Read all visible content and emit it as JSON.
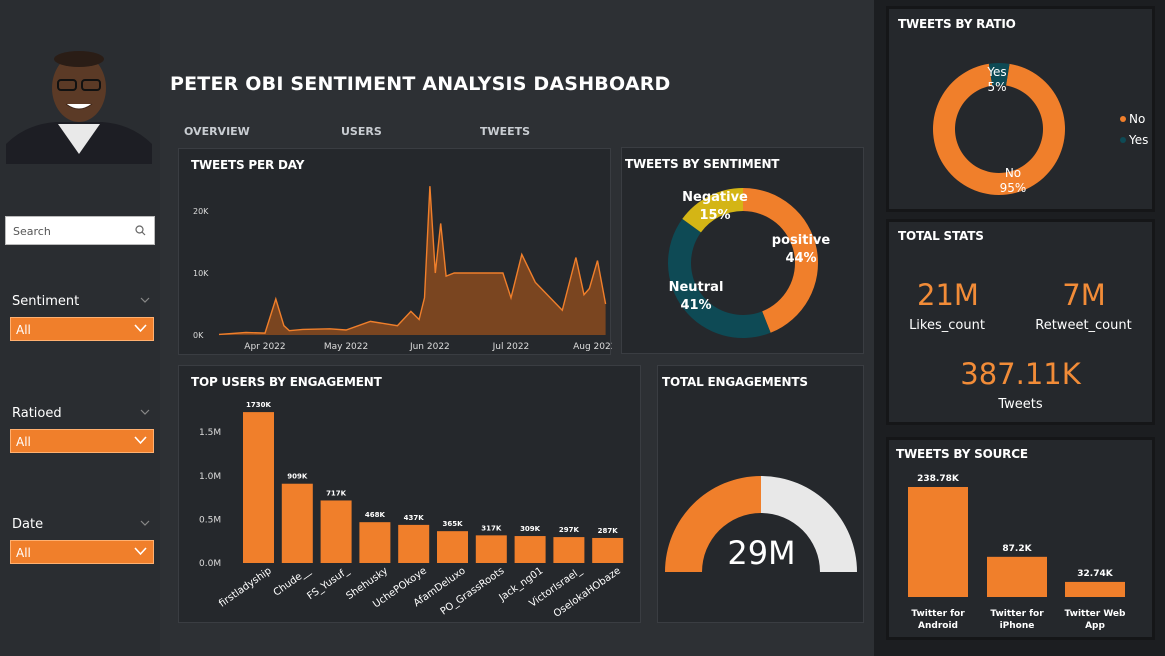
{
  "title": "PETER OBI SENTIMENT ANALYSIS DASHBOARD",
  "nav": {
    "overview": "OVERVIEW",
    "users": "USERS",
    "tweets": "TWEETS"
  },
  "colors": {
    "accent": "#f07f2b",
    "teal": "#0e4a55",
    "yellow": "#d4b515",
    "light": "#e8e8e8"
  },
  "sidebar": {
    "search_placeholder": "Search",
    "filters": [
      {
        "label": "Sentiment",
        "value": "All"
      },
      {
        "label": "Ratioed",
        "value": "All"
      },
      {
        "label": "Date",
        "value": "All"
      }
    ]
  },
  "tweets_per_day": {
    "title": "TWEETS PER DAY",
    "y_ticks": [
      "20K",
      "10K",
      "0K"
    ],
    "x_ticks": [
      "Apr 2022",
      "May 2022",
      "Jun 2022",
      "Jul 2022",
      "Aug 2022"
    ]
  },
  "sentiment": {
    "title": "TWEETS BY SENTIMENT",
    "labels": [
      {
        "name": "positive",
        "pct": "44%"
      },
      {
        "name": "Neutral",
        "pct": "41%"
      },
      {
        "name": "Negative",
        "pct": "15%"
      }
    ]
  },
  "top_users": {
    "title": "TOP USERS BY ENGAGEMENT",
    "y_ticks": [
      "1.5M",
      "1.0M",
      "0.5M",
      "0.0M"
    ]
  },
  "total_engagements": {
    "title": "TOTAL ENGAGEMENTS",
    "value": "29M"
  },
  "ratio": {
    "title": "TWEETS BY RATIO",
    "legend": [
      "No",
      "Yes"
    ],
    "yes_label": "Yes",
    "yes_pct": "5%",
    "no_label": "No",
    "no_pct": "95%"
  },
  "total_stats": {
    "title": "TOTAL STATS",
    "likes_value": "21M",
    "likes_label": "Likes_count",
    "retweet_value": "7M",
    "retweet_label": "Retweet_count",
    "tweets_value": "387.11K",
    "tweets_label": "Tweets"
  },
  "source": {
    "title": "TWEETS BY SOURCE",
    "bars": [
      {
        "label_1": "Twitter for",
        "label_2": "Android",
        "value_label": "238.78K"
      },
      {
        "label_1": "Twitter for",
        "label_2": "iPhone",
        "value_label": "87.2K"
      },
      {
        "label_1": "Twitter Web",
        "label_2": "App",
        "value_label": "32.74K"
      }
    ]
  },
  "chart_data": [
    {
      "type": "area",
      "title": "TWEETS PER DAY",
      "x_ticks": [
        "Apr 2022",
        "May 2022",
        "Jun 2022",
        "Jul 2022",
        "Aug 2022"
      ],
      "ylim": [
        0,
        20000
      ],
      "x": [
        "2022-03-15",
        "2022-03-25",
        "2022-04-01",
        "2022-04-05",
        "2022-04-08",
        "2022-04-10",
        "2022-04-15",
        "2022-04-25",
        "2022-05-01",
        "2022-05-10",
        "2022-05-20",
        "2022-05-25",
        "2022-05-28",
        "2022-05-30",
        "2022-06-01",
        "2022-06-03",
        "2022-06-05",
        "2022-06-07",
        "2022-06-10",
        "2022-06-20",
        "2022-06-28",
        "2022-07-01",
        "2022-07-05",
        "2022-07-10",
        "2022-07-20",
        "2022-07-25",
        "2022-07-28",
        "2022-07-30",
        "2022-08-02",
        "2022-08-05"
      ],
      "values": [
        100,
        400,
        300,
        5800,
        1500,
        700,
        900,
        1000,
        800,
        2200,
        1500,
        3800,
        2500,
        6000,
        24000,
        10000,
        18000,
        9500,
        10000,
        10000,
        10000,
        6000,
        13000,
        8500,
        4000,
        12500,
        6500,
        7500,
        12000,
        5000
      ]
    },
    {
      "type": "pie",
      "title": "TWEETS BY SENTIMENT",
      "categories": [
        "positive",
        "Neutral",
        "Negative"
      ],
      "values": [
        44,
        41,
        15
      ]
    },
    {
      "type": "bar",
      "title": "TOP USERS BY ENGAGEMENT",
      "categories": [
        "firstladyship",
        "Chude__",
        "FS_Yusuf_",
        "Shehusky",
        "UchePOkoye",
        "AfamDeluxo",
        "PO_GrassRoots",
        "Jack_ng01",
        "VictorIsrael_",
        "OselokaHObaze"
      ],
      "values": [
        1730000,
        909000,
        717000,
        468000,
        437000,
        365000,
        317000,
        309000,
        297000,
        287000
      ],
      "value_labels": [
        "1730K",
        "909K",
        "717K",
        "468K",
        "437K",
        "365K",
        "317K",
        "309K",
        "297K",
        "287K"
      ],
      "ylim": [
        0,
        1800000
      ]
    },
    {
      "type": "pie",
      "title": "TWEETS BY RATIO",
      "categories": [
        "No",
        "Yes"
      ],
      "values": [
        95,
        5
      ]
    },
    {
      "type": "bar",
      "title": "TWEETS BY SOURCE",
      "categories": [
        "Twitter for Android",
        "Twitter for iPhone",
        "Twitter Web App"
      ],
      "values": [
        238780,
        87200,
        32740
      ]
    }
  ]
}
